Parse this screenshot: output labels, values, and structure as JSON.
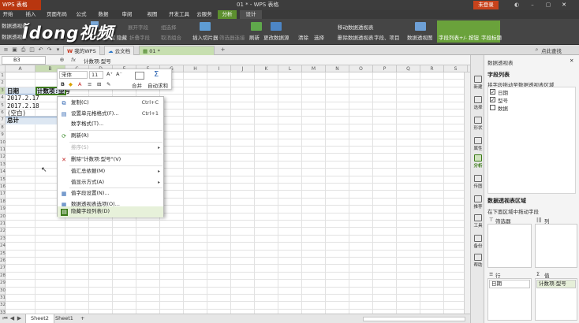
{
  "titlebar": {
    "app_name": "WPS 表格",
    "doc_title": "01 * - WPS 表格",
    "login_label": "未登录"
  },
  "menu": {
    "tabs": [
      {
        "label": "开始"
      },
      {
        "label": "插入"
      },
      {
        "label": "页面布局"
      },
      {
        "label": "公式"
      },
      {
        "label": "数据"
      },
      {
        "label": "审阅"
      },
      {
        "label": "视图"
      },
      {
        "label": "开发工具"
      },
      {
        "label": "云服务"
      },
      {
        "label": "分析"
      },
      {
        "label": "设计"
      }
    ],
    "active_tab": "分析"
  },
  "ribbon": {
    "pivot_label_top": "数据透视表",
    "pivot_label_bottom": "数据透视表",
    "watermark": "Ǐdong视频",
    "items": {
      "field_settings": "字段设置",
      "hide": "隐藏",
      "expand_field": "展开字段",
      "collapse_field": "折叠字段",
      "group_selected": "组选择",
      "ungroup": "取消组合",
      "insert_slicer": "插入切片器",
      "filter_connections": "筛选器连接",
      "refresh": "刷新",
      "change_source": "更改数据源",
      "clear": "清除",
      "select": "选择",
      "move_pivot": "移动数据透视表",
      "delete_pivot": "删除数据透视表",
      "fields_items": "字段、项目",
      "pivot_chart": "数据透视图",
      "field_list": "字段列表",
      "plus_minus": "+/- 按钮",
      "field_headers": "字段标题"
    }
  },
  "file_tabs": {
    "my_wps": "我的WPS",
    "cloud_docs": "云文档",
    "current": "01 *",
    "new_tab": "+"
  },
  "formula_bar": {
    "name_box": "B3",
    "fx": "fx",
    "formula": "计数项:型号"
  },
  "grid": {
    "columns": [
      "A",
      "B",
      "C",
      "D",
      "E",
      "F",
      "G",
      "H",
      "I",
      "J",
      "K",
      "L",
      "M",
      "N",
      "O",
      "P",
      "Q",
      "R",
      "S",
      "T"
    ],
    "rows": [
      "1",
      "2",
      "3",
      "4",
      "5",
      "6",
      "7",
      "8",
      "9",
      "10",
      "11",
      "12",
      "13",
      "14",
      "15",
      "16",
      "17",
      "18",
      "19",
      "20",
      "21",
      "22",
      "23",
      "24",
      "25",
      "26",
      "27",
      "28",
      "29",
      "30",
      "31",
      "32",
      "33"
    ],
    "cells": {
      "a3": "日期",
      "b3": "计数项:型号",
      "a4": "2017.2.17",
      "a5": "2017.2.18",
      "a6": "(空白)",
      "a7": "总计"
    }
  },
  "mini_toolbar": {
    "font_name": "宋体",
    "font_size": "11",
    "merge_label": "合并",
    "autosum_label": "自动求和"
  },
  "context_menu": {
    "items": [
      {
        "label": "复制(C)",
        "shortcut": "Ctrl+C",
        "icon": "copy-icon"
      },
      {
        "label": "设置单元格格式(F)...",
        "shortcut": "Ctrl+1",
        "icon": "format-cells-icon"
      },
      {
        "label": "数字格式(T)...",
        "shortcut": "",
        "icon": ""
      },
      {
        "label": "刷新(R)",
        "shortcut": "",
        "icon": "refresh-icon"
      },
      {
        "label": "排序(S)",
        "shortcut": "",
        "icon": "",
        "disabled": true,
        "submenu": true
      },
      {
        "label": "删除\"计数项:型号\"(V)",
        "shortcut": "",
        "icon": "delete-icon"
      },
      {
        "label": "值汇总依据(M)",
        "shortcut": "",
        "icon": "",
        "submenu": true
      },
      {
        "label": "值显示方式(A)",
        "shortcut": "",
        "icon": "",
        "submenu": true
      },
      {
        "label": "值字段设置(N)...",
        "shortcut": "",
        "icon": "field-settings-icon"
      },
      {
        "label": "数据透视表选项(O)...",
        "shortcut": "",
        "icon": "pivot-options-icon"
      },
      {
        "label": "隐藏字段列表(D)",
        "shortcut": "",
        "icon": "field-list-icon"
      }
    ]
  },
  "sheet_tabs": {
    "tabs": [
      "Sheet2",
      "Sheet1"
    ],
    "active": "Sheet2",
    "add": "+"
  },
  "side_pane": {
    "items": [
      {
        "label": "新建",
        "icon": "new-icon"
      },
      {
        "label": "选择",
        "icon": "select-icon"
      },
      {
        "label": "形状",
        "icon": "shape-icon"
      },
      {
        "label": "属性",
        "icon": "property-icon"
      },
      {
        "label": "分析",
        "icon": "analysis-icon"
      },
      {
        "label": "传图",
        "icon": "image-icon"
      },
      {
        "label": "推荐",
        "icon": "recommend-icon"
      },
      {
        "label": "工具",
        "icon": "tools-icon"
      },
      {
        "label": "备份",
        "icon": "backup-icon"
      },
      {
        "label": "帮助",
        "icon": "help-icon"
      }
    ]
  },
  "task_pane": {
    "header": "数据透视表",
    "search_hint": "点此查找",
    "field_list_title": "字段列表",
    "field_list_hint": "将字段拖动至数据透视表区域",
    "fields": [
      {
        "label": "日期",
        "checked": true
      },
      {
        "label": "型号",
        "checked": true
      },
      {
        "label": "数据",
        "checked": false
      }
    ],
    "areas_title": "数据透视表区域",
    "areas_hint": "在下面区域中拖动字段",
    "filter_label": "筛选器",
    "columns_label": "列",
    "rows_label": "行",
    "values_label": "值",
    "row_field": "日期",
    "value_field": "计数项:型号"
  }
}
